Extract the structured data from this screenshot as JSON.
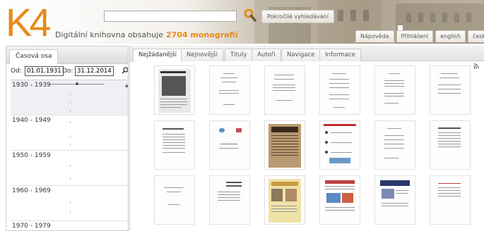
{
  "header": {
    "logo": "K4",
    "tagline_prefix": "Digitální knihovna obsahuje",
    "tagline_count": "2704 monografií",
    "search_placeholder": "",
    "advanced_search_label": "Pokročilé vyhledávání",
    "links": [
      "Nápověda",
      "Přihlášení",
      "english",
      "česky"
    ]
  },
  "timeline_panel": {
    "tab_label": "Časová osa",
    "from_label": "Od:",
    "from_value": "01.01.1931",
    "to_label": "Do:",
    "to_value": "31.12.2014",
    "decades": [
      "1930 - 1939",
      "1940 - 1949",
      "1950 - 1959",
      "1960 - 1969",
      "1970 - 1979"
    ]
  },
  "results_panel": {
    "tabs": [
      "Nejžádanější",
      "Nejnovější",
      "Tituly",
      "Autoři",
      "Navigace",
      "Informace"
    ],
    "active_tab": "Nejžádanější"
  },
  "colors": {
    "accent": "#e88a1a",
    "border": "#cdcdcd"
  }
}
